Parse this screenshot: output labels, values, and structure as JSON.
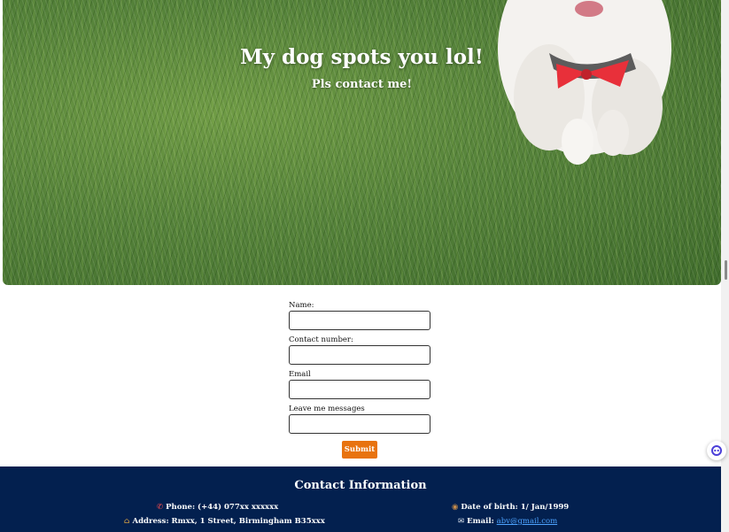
{
  "hero": {
    "title": "My dog spots you lol!",
    "subtitle": "Pls contact me!"
  },
  "form": {
    "name_label": "Name:",
    "contact_label": "Contact number:",
    "email_label": "Email",
    "message_label": "Leave me messages",
    "submit_label": "Submit"
  },
  "footer": {
    "title": "Contact Information",
    "phone_label": "Phone: (+44) 077xx xxxxxx",
    "address_label": "Address: Rmxx, 1 Street, Birmingham B35xxx",
    "dob_label": "Date of birth: 1/ Jan/1999",
    "email_prefix": "Email: ",
    "email_link": "abv@gmail.com"
  },
  "icons": {
    "phone": "phone-icon",
    "home": "house-icon",
    "dob": "cake-icon",
    "email": "envelope-icon"
  },
  "colors": {
    "footer_bg": "#03204f",
    "submit_bg": "#e8730f",
    "link": "#4da3ff"
  }
}
